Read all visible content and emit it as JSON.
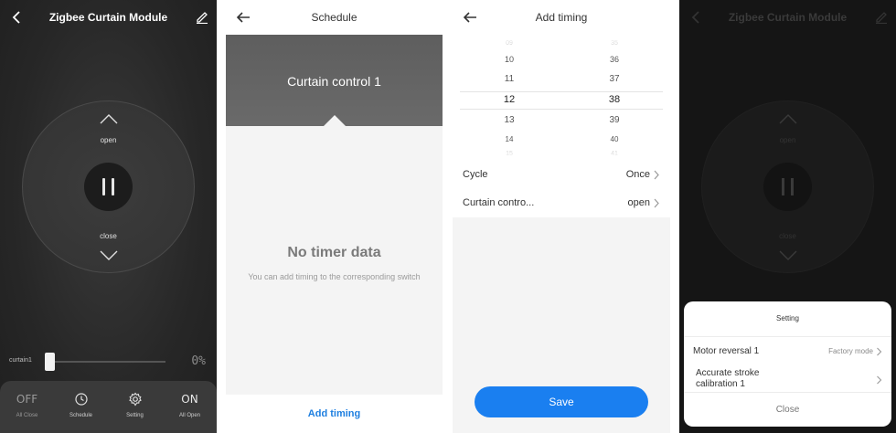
{
  "panel1": {
    "title": "Zigbee Curtain Module",
    "control": {
      "open_label": "open",
      "close_label": "close"
    },
    "slider": {
      "label": "curtain1",
      "value_text": "0%",
      "level": 0
    },
    "bottom_bar": [
      {
        "big": "OFF",
        "caption": "All Close",
        "icon": null
      },
      {
        "big": "",
        "caption": "Schedule",
        "icon": "clock-icon"
      },
      {
        "big": "",
        "caption": "Setting",
        "icon": "gear-icon"
      },
      {
        "big": "ON",
        "caption": "All Open",
        "icon": null
      }
    ]
  },
  "panel2": {
    "title": "Schedule",
    "hero_title": "Curtain control 1",
    "empty_title": "No timer data",
    "empty_subtitle": "You can add timing to the corresponding switch",
    "add_timing": "Add timing"
  },
  "panel3": {
    "title": "Add timing",
    "hours": [
      "09",
      "10",
      "11",
      "12",
      "13",
      "14",
      "15"
    ],
    "minutes": [
      "35",
      "36",
      "37",
      "38",
      "39",
      "40",
      "41"
    ],
    "selected_hour": "12",
    "selected_minute": "38",
    "cycle": {
      "label": "Cycle",
      "value": "Once"
    },
    "curtain": {
      "label": "Curtain contro...",
      "value": "open"
    },
    "save": "Save"
  },
  "panel4": {
    "title": "Zigbee Curtain Module",
    "open_label": "open",
    "close_label": "close",
    "sheet": {
      "title": "Setting",
      "rows": [
        {
          "label": "Motor reversal 1",
          "value": "Factory mode"
        },
        {
          "label": "Accurate stroke calibration 1",
          "value": ""
        }
      ],
      "close": "Close"
    }
  },
  "colors": {
    "accent_blue": "#1a7ff0",
    "link_blue": "#1e7fe0",
    "dark_bg": "#272727"
  }
}
